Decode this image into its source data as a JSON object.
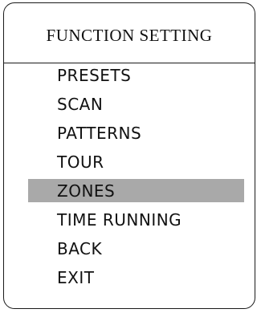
{
  "menu": {
    "title": "FUNCTION SETTING",
    "selected_index": 4,
    "items": [
      {
        "label": "PRESETS"
      },
      {
        "label": "SCAN"
      },
      {
        "label": "PATTERNS"
      },
      {
        "label": "TOUR"
      },
      {
        "label": "ZONES"
      },
      {
        "label": "TIME RUNNING"
      },
      {
        "label": "BACK"
      },
      {
        "label": "EXIT"
      }
    ]
  },
  "colors": {
    "highlight": "#a9a9a9",
    "border": "#1a1a1a",
    "text": "#111111",
    "background": "#ffffff"
  }
}
